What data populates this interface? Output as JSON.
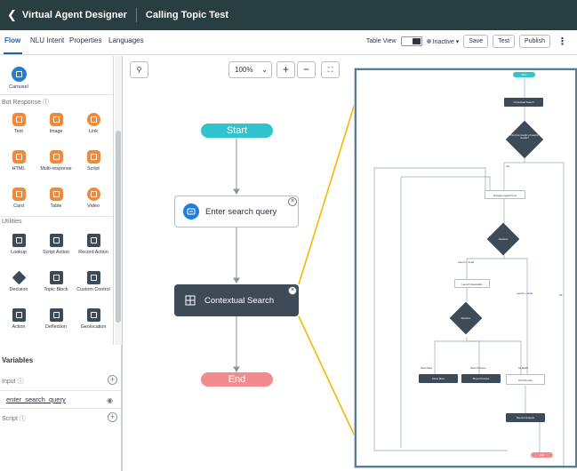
{
  "header": {
    "back_label": "Virtual Agent Designer",
    "topic_title": "Calling Topic Test"
  },
  "tabs": [
    "Flow",
    "NLU Intent",
    "Properties",
    "Languages"
  ],
  "toolbar": {
    "table_view_label": "Table View",
    "status_label": "Inactive",
    "save_label": "Save",
    "test_label": "Test",
    "publish_label": "Publish"
  },
  "palette": {
    "top_item": "Carousel",
    "bot_response_title": "Bot Response",
    "bot_response_items": [
      "Text",
      "Image",
      "Link",
      "HTML",
      "Multi-response",
      "Script",
      "Card",
      "Table",
      "Video"
    ],
    "utilities_title": "Utilities",
    "utilities_items": [
      "Lookup",
      "Script Action",
      "Record Action",
      "Decision",
      "Topic Block",
      "Custom Control",
      "Action",
      "Deflection",
      "Geolocation"
    ]
  },
  "variables": {
    "title": "Variables",
    "input_label": "Input",
    "input_var": "enter_search_query",
    "script_label": "Script"
  },
  "canvas": {
    "zoom": "100%",
    "start": "Start",
    "node1": "Enter search query",
    "node2": "Contextual Search",
    "end": "End"
  },
  "subflow": {
    "start": "Start",
    "search_node": "Contextual Search",
    "decision1": "Find the results of search results?",
    "yes": "Yes",
    "question_node": "Dungeon search List",
    "decision2": "Decision",
    "branch_a": "Launch + Small",
    "branch_b": "Launch + Large",
    "branch_c": "No",
    "sub_question": "Launch Specialists",
    "decision3": "Decision",
    "show_more": "Show More",
    "show_previous": "Show Previous",
    "no_match": "No Match",
    "out_a": "Show More",
    "out_b": "Show Previous",
    "out_c": "Did this help",
    "record": "Record Analysis",
    "end": "End"
  },
  "colors": {
    "header_bg": "#293e40",
    "accent": "#1f5fb8",
    "start": "#31c4ce",
    "end": "#f28b8d",
    "node_dark": "#3d4a57",
    "callout": "#f5b800"
  }
}
